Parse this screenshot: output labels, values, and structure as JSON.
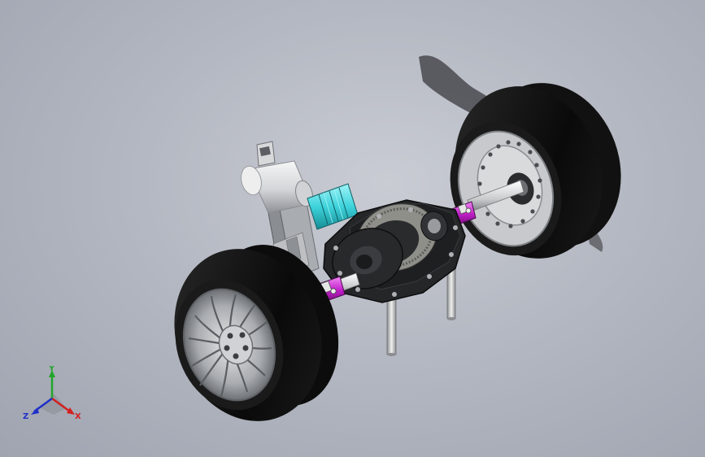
{
  "viewport": {
    "background_color": "#b4b8c2"
  },
  "model": {
    "tire_color": "#0e0e0e",
    "rim_color": "#bfc2c6",
    "housing_color": "#232325",
    "gear_color": "#8c8c86",
    "coupling_color": "#3ed3dc",
    "ujoint_color": "#c21fc9",
    "shaft_color": "#d9dbdc",
    "motor_color": "#e4e5e6"
  },
  "triad": {
    "x_label": "X",
    "y_label": "Y",
    "z_label": "Z",
    "x_color": "#d42020",
    "y_color": "#22a52a",
    "z_color": "#2030c8"
  }
}
